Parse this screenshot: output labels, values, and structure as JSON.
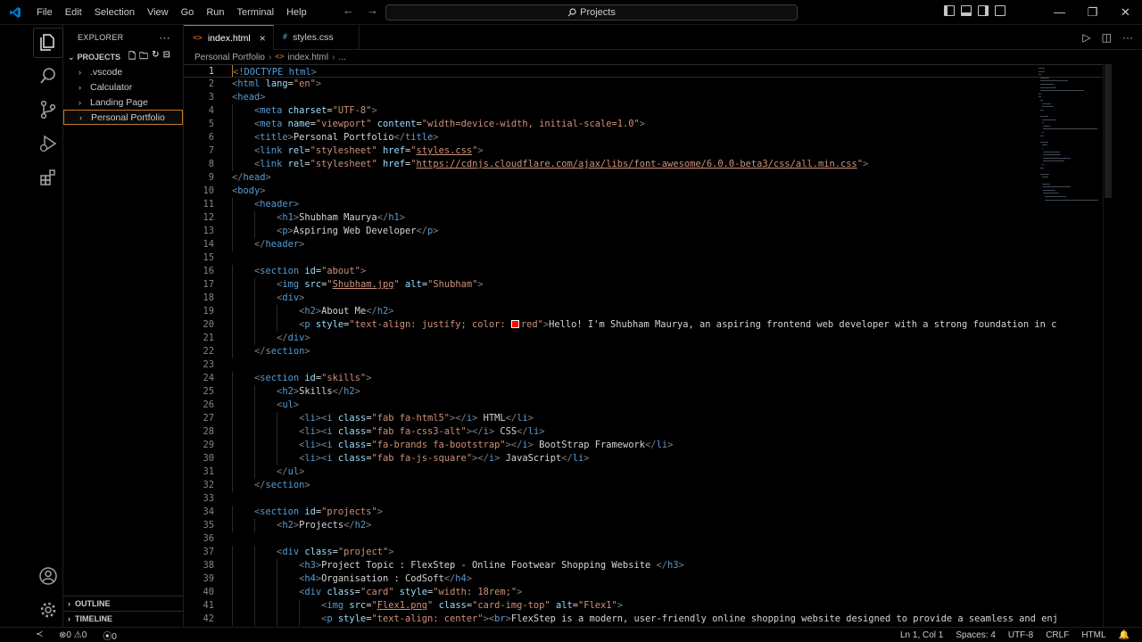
{
  "titlebar": {
    "menu": [
      "File",
      "Edit",
      "Selection",
      "View",
      "Go",
      "Run",
      "Terminal",
      "Help"
    ],
    "search_text": "Projects",
    "accent": "#007acc"
  },
  "sidebar": {
    "header": "EXPLORER",
    "more": "···",
    "section": "PROJECTS",
    "items": [
      {
        "label": ".vscode"
      },
      {
        "label": "Calculator"
      },
      {
        "label": "Landing Page"
      },
      {
        "label": "Personal Portfolio"
      }
    ],
    "outline": "OUTLINE",
    "timeline": "TIMELINE"
  },
  "tabs": [
    {
      "label": "index.html",
      "icon": "<>"
    },
    {
      "label": "styles.css",
      "icon": "#"
    }
  ],
  "breadcrumb": {
    "folder": "Personal Portfolio",
    "file": "index.html",
    "rest": "..."
  },
  "editor": {
    "lines": [
      "<!DOCTYPE html>",
      "<html lang=\"en\">",
      "<head>",
      "    <meta charset=\"UTF-8\">",
      "    <meta name=\"viewport\" content=\"width=device-width, initial-scale=1.0\">",
      "    <title>Personal Portfolio</title>",
      "    <link rel=\"stylesheet\" href=\"styles.css\">",
      "    <link rel=\"stylesheet\" href=\"https://cdnjs.cloudflare.com/ajax/libs/font-awesome/6.0.0-beta3/css/all.min.css\">",
      "</head>",
      "<body>",
      "    <header>",
      "        <h1>Shubham Maurya</h1>",
      "        <p>Aspiring Web Developer</p>",
      "    </header>",
      "",
      "    <section id=\"about\">",
      "        <img src=\"Shubham.jpg\" alt=\"Shubham\">",
      "        <div>",
      "            <h2>About Me</h2>",
      "            <p style=\"text-align: justify; color: red\">Hello! I'm Shubham Maurya, an aspiring frontend web developer with a strong foundation in c",
      "        </div>",
      "    </section>",
      "",
      "    <section id=\"skills\">",
      "        <h2>Skills</h2>",
      "        <ul>",
      "            <li><i class=\"fab fa-html5\"></i> HTML</li>",
      "            <li><i class=\"fab fa-css3-alt\"></i> CSS</li>",
      "            <li><i class=\"fa-brands fa-bootstrap\"></i> BootStrap Framework</li>",
      "            <li><i class=\"fab fa-js-square\"></i> JavaScript</li>",
      "        </ul>",
      "    </section>",
      "",
      "    <section id=\"projects\">",
      "        <h2>Projects</h2>",
      "",
      "        <div class=\"project\">",
      "            <h3>Project Topic : FlexStep - Online Footwear Shopping Website </h3>",
      "            <h4>Organisation : CodSoft</h4>",
      "            <div class=\"card\" style=\"width: 18rem;\">",
      "                <img src=\"Flex1.png\" class=\"card-img-top\" alt=\"Flex1\">",
      "                <p style=\"text-align: center\"><br>FlexStep is a modern, user-friendly online shopping website designed to provide a seamless and enj"
    ]
  },
  "statusbar": {
    "errors": "0",
    "warnings": "0",
    "ports": "0",
    "position": "Ln 1, Col 1",
    "spaces": "Spaces: 4",
    "encoding": "UTF-8",
    "eol": "CRLF",
    "language": "HTML"
  }
}
